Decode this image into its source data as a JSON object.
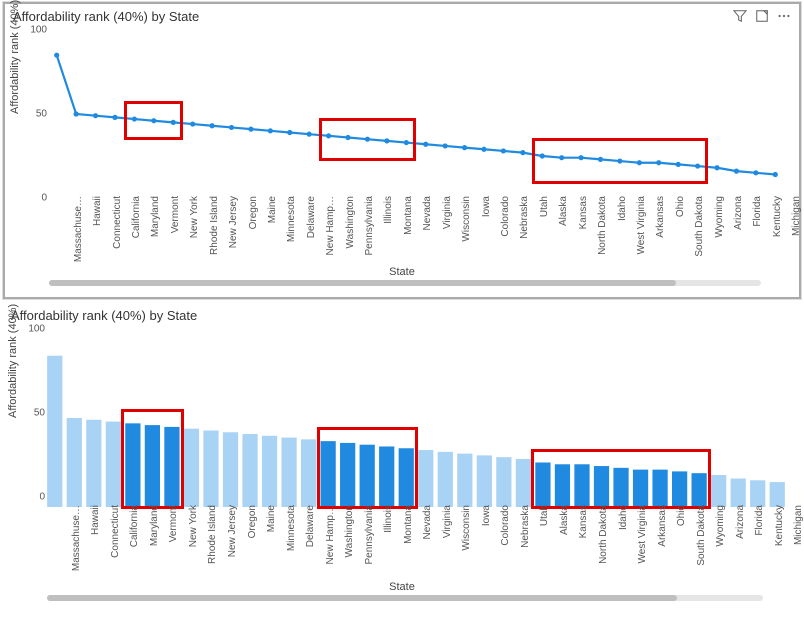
{
  "charts": [
    {
      "title": "Affordability rank (40%) by State",
      "ylabel": "Affordability rank (40%)",
      "xlabel": "State"
    },
    {
      "title": "Affordability rank (40%) by State",
      "ylabel": "Affordability rank (40%)",
      "xlabel": "State"
    }
  ],
  "y_ticks": [
    "0",
    "50",
    "100"
  ],
  "colors": {
    "accent": "#1f8ae0",
    "light": "#a9d3f5",
    "highlight": "#e10000"
  },
  "icons": {
    "filter": "filter-icon",
    "focus": "focus-icon",
    "more": "more-icon"
  },
  "chart_data": {
    "type": "bar",
    "title": "Affordability rank (40%) by State",
    "xlabel": "State",
    "ylabel": "Affordability rank (40%)",
    "ylim": [
      0,
      100
    ],
    "categories": [
      "Massachuse…",
      "Hawaii",
      "Connecticut",
      "California",
      "Maryland",
      "Vermont",
      "New York",
      "Rhode Island",
      "New Jersey",
      "Oregon",
      "Maine",
      "Minnesota",
      "Delaware",
      "New Hamp…",
      "Washington",
      "Pennsylvania",
      "Illinois",
      "Montana",
      "Nevada",
      "Virginia",
      "Wisconsin",
      "Iowa",
      "Colorado",
      "Nebraska",
      "Utah",
      "Alaska",
      "Kansas",
      "North Dakota",
      "Idaho",
      "West Virginia",
      "Arkansas",
      "Ohio",
      "South Dakota",
      "Wyoming",
      "Arizona",
      "Florida",
      "Kentucky",
      "Michigan"
    ],
    "values": [
      85,
      50,
      49,
      48,
      47,
      46,
      45,
      44,
      43,
      42,
      41,
      40,
      39,
      38,
      37,
      36,
      35,
      34,
      33,
      32,
      31,
      30,
      29,
      28,
      27,
      25,
      24,
      24,
      23,
      22,
      21,
      21,
      20,
      19,
      18,
      16,
      15,
      14
    ],
    "series": [
      {
        "name": "Affordability rank (40%)",
        "values": [
          85,
          50,
          49,
          48,
          47,
          46,
          45,
          44,
          43,
          42,
          41,
          40,
          39,
          38,
          37,
          36,
          35,
          34,
          33,
          32,
          31,
          30,
          29,
          28,
          27,
          25,
          24,
          24,
          23,
          22,
          21,
          21,
          20,
          19,
          18,
          16,
          15,
          14
        ]
      }
    ],
    "highlighted_indices": [
      [
        4,
        5,
        6
      ],
      [
        14,
        15,
        16,
        17,
        18
      ],
      [
        25,
        26,
        27,
        28,
        29,
        30,
        31,
        32,
        33
      ]
    ],
    "highlighted_states": [
      "Maryland",
      "Vermont",
      "New York",
      "Washington",
      "Pennsylvania",
      "Illinois",
      "Montana",
      "Nevada",
      "Alaska",
      "Kansas",
      "North Dakota",
      "Idaho",
      "West Virginia",
      "Arkansas",
      "Ohio",
      "South Dakota",
      "Wyoming"
    ]
  },
  "scroll": {
    "thumb_left_pct": 0,
    "thumb_width_pct": 88
  }
}
